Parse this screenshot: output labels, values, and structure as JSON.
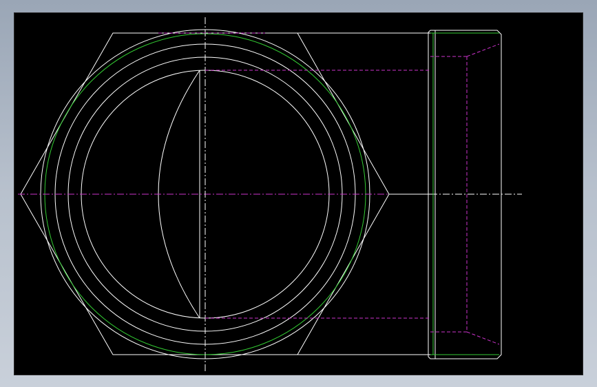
{
  "drawing": {
    "background": "#000000",
    "line_color_visible": "#ffffff",
    "line_color_hidden": "#cc33cc",
    "line_color_thread": "#33cc33",
    "views": [
      "front-view",
      "side-view"
    ]
  },
  "frame": {
    "outer_gradient_top": "#9aa6b6",
    "outer_gradient_bottom": "#c9d0da"
  }
}
